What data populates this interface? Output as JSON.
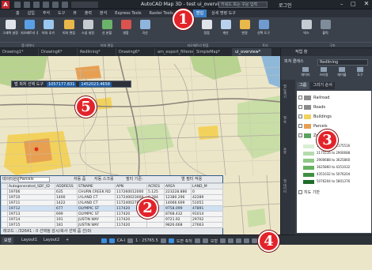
{
  "app": {
    "logo": "A",
    "title": "AutoCAD Map 3D - test   ui_overview.dwg",
    "search_placeholder": "키워드 또는 구문 입력",
    "signin": "로그인",
    "window_controls": {
      "minimize": "–",
      "maximize": "□",
      "close": "✕"
    }
  },
  "ribbon": {
    "tabs": [
      {
        "label": "홈",
        "active": false
      },
      {
        "label": "삽입",
        "active": false
      },
      {
        "label": "주석",
        "active": false
      },
      {
        "label": "도구",
        "active": false
      },
      {
        "label": "뷰",
        "active": false
      },
      {
        "label": "출력",
        "active": false
      },
      {
        "label": "분석",
        "active": false
      },
      {
        "label": "Express Tools",
        "active": false
      },
      {
        "label": "Raster Tools",
        "active": false
      },
      {
        "label": "협업",
        "active": false
      },
      {
        "label": "편집",
        "active": true
      },
      {
        "label": "상세 명령 도구",
        "active": false
      }
    ],
    "buttons": [
      {
        "label": "그래픽 설정",
        "icon": "graphics-icon",
        "color": "#e0e4ea"
      },
      {
        "label": "지오메트리 추가",
        "icon": "add-geometry-icon",
        "color": "#5aa0e6"
      },
      {
        "label": "피처 추가",
        "icon": "add-feature-icon",
        "color": "#9ac7f0"
      },
      {
        "label": "피처 편집",
        "icon": "edit-feature-icon",
        "color": "#e8b84a"
      },
      {
        "label": "스냅 설정",
        "icon": "snap-icon",
        "color": "#c7ccd3"
      },
      {
        "label": "선 분할",
        "icon": "split-icon",
        "color": "#6bb36a"
      },
      {
        "label": "병합",
        "icon": "merge-icon",
        "color": "#d9534f"
      },
      {
        "label": "곡선",
        "icon": "curve-icon",
        "color": "#8fb4dd"
      },
      {
        "label": "정점",
        "icon": "vertex-icon",
        "color": "#e0e4ea"
      },
      {
        "label": "계산",
        "icon": "calc-icon",
        "color": "#b8d1ec"
      },
      {
        "label": "변경",
        "icon": "modify-icon",
        "color": "#e8b84a"
      },
      {
        "label": "선택 도구",
        "icon": "select-icon",
        "color": "#6f9bd1"
      },
      {
        "label": "박스",
        "icon": "box-icon",
        "color": "#c7ccd3"
      },
      {
        "label": "블럭",
        "icon": "block-icon",
        "color": "#7f8c99"
      }
    ],
    "groups": [
      {
        "label": "맵 데이터"
      },
      {
        "label": "피처 편집"
      },
      {
        "label": "지오메트리 편집"
      },
      {
        "label": "트리"
      },
      {
        "label": "구조"
      }
    ]
  },
  "doc_tabs": [
    {
      "label": "Drawing1*",
      "active": false
    },
    {
      "label": "Drawing6*",
      "active": false
    },
    {
      "label": "Redlining*",
      "active": false
    },
    {
      "label": "Drawing6*",
      "active": false
    },
    {
      "label": "am_export_filtered_parcels*",
      "active": false
    },
    {
      "label": "SimpleMap*",
      "active": false
    },
    {
      "label": "ui_overview*",
      "active": true
    }
  ],
  "map": {
    "tooltip_label": "맵 피처 선택 도구",
    "tooltip_x": "1057177.831",
    "tooltip_y": "1452023.4658",
    "colors": {
      "background": "#ece6c8",
      "roads": "#b0a9a0",
      "water": "#8fb8d8",
      "park": "#b7d38f",
      "parcel_yellow": "#f2d25c",
      "parcel_orange": "#e7a052"
    }
  },
  "datatable": {
    "toolbar_label": "데이터원본",
    "source": "Parcels",
    "toolbar_items": [
      "자동 줌",
      "자동 스크롤",
      "필터 기준:",
      "열 필터 적용"
    ],
    "columns": [
      "",
      "Autogenerated_SDF_ID",
      "ADDRESS",
      "STNAME",
      "APN",
      "ACRES",
      "AREA",
      "LAND_M"
    ],
    "rows": [
      [
        "",
        "19706",
        "635",
        "CHURN CREEK RD",
        "117260012000",
        "5.125",
        "223228.886",
        "0"
      ],
      [
        "",
        "19710",
        "1400",
        "LYLAND CT",
        "117240023000",
        "0.284",
        "12380.296",
        "42289"
      ],
      [
        "",
        "19711",
        "1422",
        "LYLAND CT",
        "117240027000",
        "0.323",
        "14066.609",
        "51051"
      ],
      [
        "",
        "19712",
        "677",
        "OLYMPIC ST",
        "117420",
        "",
        "9758.099",
        "47891"
      ],
      [
        "",
        "19713",
        "699",
        "OLYMPIC ST",
        "117420",
        "",
        "8768.432",
        "91014"
      ],
      [
        "",
        "19714",
        "191",
        "JUSTIN WAY",
        "117420",
        "",
        "9721.92",
        "29702"
      ],
      [
        "",
        "19715",
        "181",
        "JUSTIN WAY",
        "117420",
        "",
        "9826.668",
        "27663"
      ]
    ],
    "status": "레코드 : /32641 : 0 선택됨   감시/복사 선택   줌 선(0)"
  },
  "layout_tabs": [
    {
      "label": "모형",
      "active": true
    },
    {
      "label": "Layout1",
      "active": false
    },
    {
      "label": "Layout2",
      "active": false
    },
    {
      "label": "+",
      "active": false
    }
  ],
  "statusbar": {
    "coords_label": "CA-I",
    "scale": "1 : 25765.5",
    "unit": "도면 축척",
    "mode": "모형"
  },
  "taskpane": {
    "title": "작업 창",
    "explorer_label": "피쳐 클래스",
    "explorer_value": "Redlining",
    "tools": [
      {
        "label": "데이터",
        "icon": "data-icon"
      },
      {
        "label": "스타일",
        "icon": "style-icon"
      },
      {
        "label": "테이블",
        "icon": "table-icon"
      },
      {
        "label": "도구",
        "icon": "tools-icon"
      }
    ],
    "subtabs": [
      {
        "label": "그룹",
        "active": true
      },
      {
        "label": "그리기 순서",
        "active": false
      }
    ],
    "side_labels": [
      "맵 탐색기",
      "맵 북",
      "측량",
      "맵 데이터"
    ],
    "layers": [
      {
        "label": "Railroad",
        "color": "#8a8a8a"
      },
      {
        "label": "Roads",
        "color": "#8a8a8a"
      },
      {
        "label": "Buildings",
        "color": "#f2d25c"
      },
      {
        "label": "Parcels",
        "color": "#e7a052"
      },
      {
        "label": "Zoning",
        "color": "#5aa35f"
      }
    ],
    "legend": [
      {
        "label": "1450344 to 2175516",
        "color": "#d9eed3"
      },
      {
        "label": "2175516 to 2900688",
        "color": "#b5dcae"
      },
      {
        "label": "2900688 to 3625860",
        "color": "#8ec887"
      },
      {
        "label": "3625860 to 4351032",
        "color": "#66b160"
      },
      {
        "label": "4351032 to 5076204",
        "color": "#3f9140"
      },
      {
        "label": "5076204 to 5801376",
        "color": "#1f6b2a"
      }
    ],
    "base_label": "지도 기반"
  },
  "badges": [
    "1",
    "2",
    "3",
    "4",
    "5"
  ]
}
